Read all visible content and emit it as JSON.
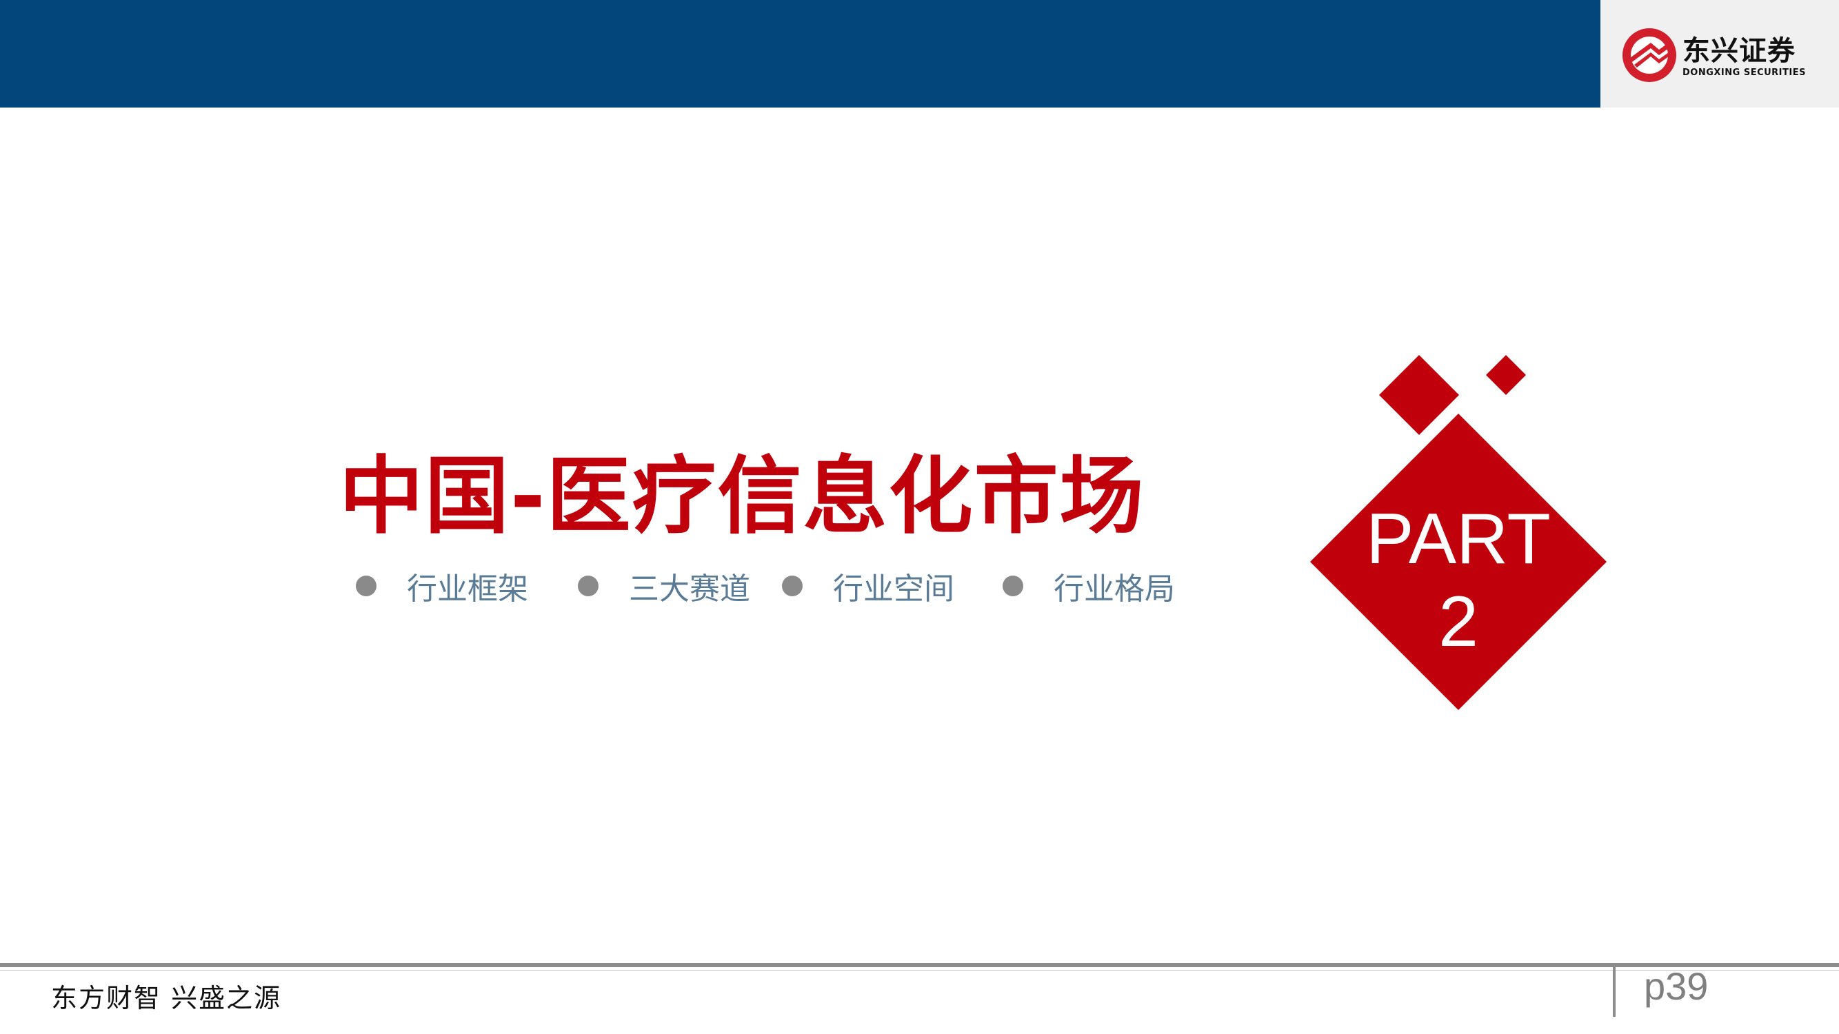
{
  "header": {
    "logo": {
      "name_cn": "东兴证券",
      "name_en": "DONGXING SECURITIES",
      "icon": "dongxing-logo-icon"
    }
  },
  "section": {
    "title": "中国-医疗信息化市场",
    "bullets": [
      "行业框架",
      "三大赛道",
      "行业空间",
      "行业格局"
    ],
    "part_label": "PART",
    "part_number": "2"
  },
  "footer": {
    "slogan": "东方财智 兴盛之源",
    "page": "p39"
  },
  "colors": {
    "header_blue": "#02467b",
    "accent_red": "#c0000b",
    "bullet_text": "#5a7b96",
    "bullet_dot": "#8a8a8a"
  }
}
